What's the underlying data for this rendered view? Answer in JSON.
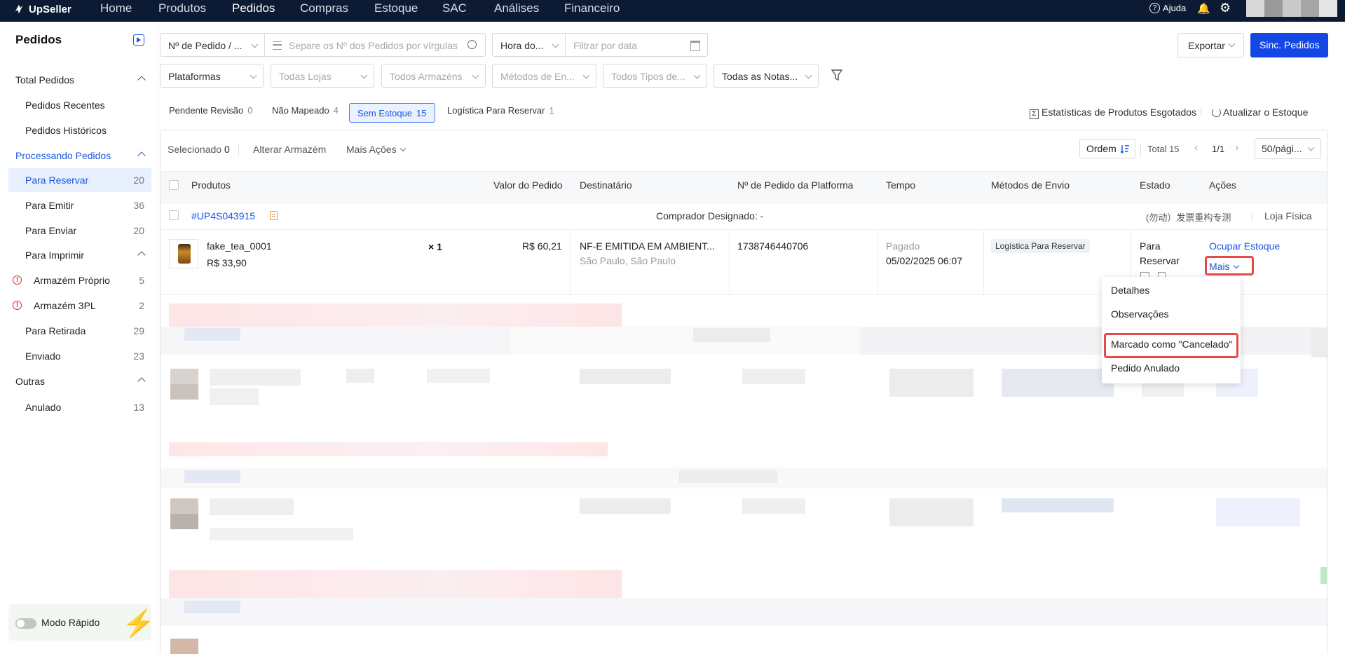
{
  "nav": {
    "brand": "UpSeller",
    "items": [
      "Home",
      "Produtos",
      "Pedidos",
      "Compras",
      "Estoque",
      "SAC",
      "Análises",
      "Financeiro"
    ],
    "active": "Pedidos",
    "help": "Ajuda"
  },
  "sidebar": {
    "title": "Pedidos",
    "total_pedidos": "Total Pedidos",
    "recentes": "Pedidos Recentes",
    "historicos": "Pedidos Históricos",
    "processando": "Processando Pedidos",
    "items": [
      {
        "label": "Para Reservar",
        "count": "20"
      },
      {
        "label": "Para Emitir",
        "count": "36"
      },
      {
        "label": "Para Enviar",
        "count": "20"
      },
      {
        "label": "Para Imprimir",
        "count": ""
      },
      {
        "label": "Armazém Próprio",
        "count": "5"
      },
      {
        "label": "Armazém 3PL",
        "count": "2"
      },
      {
        "label": "Para Retirada",
        "count": "29"
      },
      {
        "label": "Enviado",
        "count": "23"
      }
    ],
    "outras": "Outras",
    "anulado": {
      "label": "Anulado",
      "count": "13"
    },
    "modo_rapido": "Modo Rápido"
  },
  "filters": {
    "pedido_select": "Nº de Pedido / ...",
    "pedido_placeholder": "Separe os Nº dos Pedidos por vírgulas",
    "hora_select": "Hora do...",
    "data_placeholder": "Filtrar por data",
    "plataformas": "Plataformas",
    "lojas": "Todas Lojas",
    "armazens": "Todos Armazéns",
    "metodos": "Métodos de En...",
    "tipos": "Todos Tipos de...",
    "notas": "Todas as Notas..."
  },
  "actions": {
    "exportar": "Exportar",
    "sinc": "Sinc. Pedidos"
  },
  "tabs": [
    {
      "label": "Pendente Revisão",
      "count": "0"
    },
    {
      "label": "Não Mapeado",
      "count": "4"
    },
    {
      "label": "Sem Estoque",
      "count": "15"
    },
    {
      "label": "Logística Para Reservar",
      "count": "1"
    }
  ],
  "links": {
    "estatisticas": "Estatísticas de Produtos Esgotados",
    "atualizar": "Atualizar o Estoque"
  },
  "toolbar": {
    "selecionado": "Selecionado",
    "selecionado_count": "0",
    "alterar": "Alterar Armazém",
    "mais_acoes": "Mais Ações",
    "ordem": "Ordem",
    "total": "Total 15",
    "page": "1/1",
    "per_page": "50/pági..."
  },
  "columns": [
    "Produtos",
    "Valor do Pedido",
    "Destinatário",
    "Nº de Pedido da Platforma",
    "Tempo",
    "Métodos de Envio",
    "Estado",
    "Ações"
  ],
  "order": {
    "id": "#UP4S043915",
    "comprador": "Comprador Designado: -",
    "tag": "(勿动）发票重构专测",
    "loja": "Loja Física",
    "product_name": "fake_tea_0001",
    "product_price": "R$ 33,90",
    "qty": "× 1",
    "valor": "R$ 60,21",
    "dest_name": "NF-E EMITIDA EM AMBIENT...",
    "dest_city": "São Paulo, São Paulo",
    "platform_no": "1738746440706",
    "status_time": "Pagado",
    "date": "05/02/2025 06:07",
    "envio": "Logística Para Reservar",
    "estado_1": "Para",
    "estado_2": "Reservar",
    "ocupar": "Ocupar Estoque",
    "mais": "Mais"
  },
  "menu": [
    "Detalhes",
    "Observações",
    "Marcado como \"Cancelado\"",
    "Pedido Anulado"
  ],
  "colors": {
    "nav_bg": "#0c1a33",
    "accent": "#1447e6",
    "highlight": "#e5484d"
  }
}
